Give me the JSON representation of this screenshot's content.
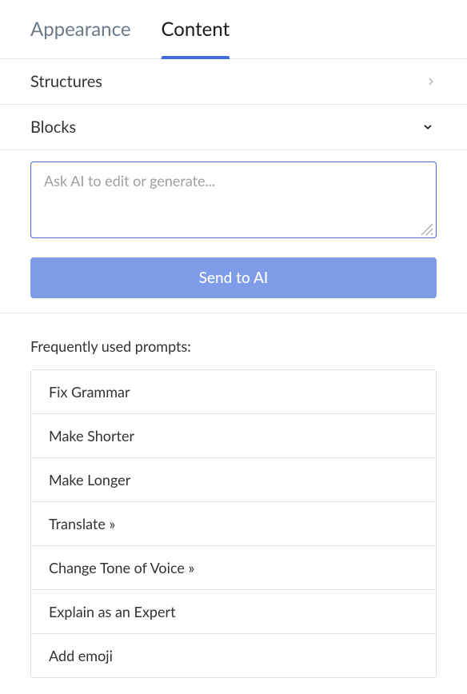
{
  "tabs": {
    "appearance": "Appearance",
    "content": "Content"
  },
  "sections": {
    "structures": "Structures",
    "blocks": "Blocks"
  },
  "ai": {
    "placeholder": "Ask AI to edit or generate...",
    "value": "",
    "send_label": "Send to AI"
  },
  "prompts": {
    "title": "Frequently used prompts:",
    "items": [
      "Fix Grammar",
      "Make Shorter",
      "Make Longer",
      "Translate »",
      "Change Tone of Voice »",
      "Explain as an Expert",
      "Add emoji"
    ]
  }
}
